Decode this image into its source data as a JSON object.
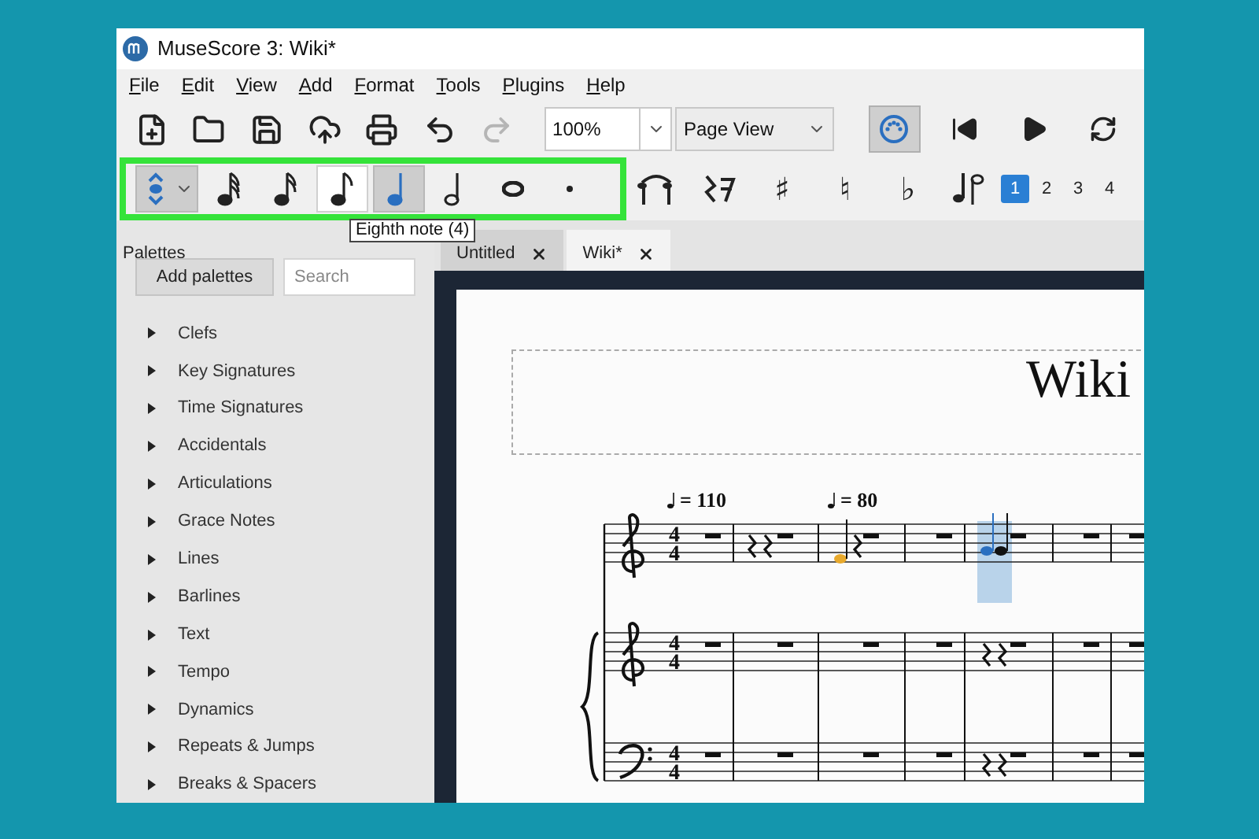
{
  "window": {
    "title": "MuseScore 3: Wiki*"
  },
  "menu": [
    "File",
    "Edit",
    "View",
    "Add",
    "Format",
    "Tools",
    "Plugins",
    "Help"
  ],
  "toolbar": [
    {
      "kind": "new",
      "disabled": false
    },
    {
      "kind": "open",
      "disabled": false
    },
    {
      "kind": "save",
      "disabled": false
    },
    {
      "kind": "upload",
      "disabled": false
    },
    {
      "kind": "print",
      "disabled": false
    },
    {
      "kind": "undo",
      "disabled": false
    },
    {
      "kind": "redo",
      "disabled": true
    }
  ],
  "zoom": {
    "value": "100%"
  },
  "view_mode": {
    "value": "Page View"
  },
  "playback": [
    {
      "kind": "midi",
      "selected": true
    },
    {
      "kind": "rewind",
      "selected": false
    },
    {
      "kind": "play",
      "selected": false
    },
    {
      "kind": "loop",
      "selected": false
    }
  ],
  "note_tools": [
    {
      "kind": "input-mode",
      "selected": true,
      "hovered": false
    },
    {
      "kind": "thirty-second",
      "selected": false,
      "hovered": false
    },
    {
      "kind": "sixteenth",
      "selected": false,
      "hovered": false
    },
    {
      "kind": "eighth",
      "selected": false,
      "hovered": true
    },
    {
      "kind": "quarter",
      "selected": true,
      "hovered": false
    },
    {
      "kind": "half",
      "selected": false,
      "hovered": false
    },
    {
      "kind": "whole",
      "selected": false,
      "hovered": false
    },
    {
      "kind": "dot",
      "selected": false,
      "hovered": false
    }
  ],
  "edit_tools": [
    {
      "kind": "tie"
    },
    {
      "kind": "rest"
    },
    {
      "kind": "accidental",
      "label": "♯"
    },
    {
      "kind": "accidental",
      "label": "♮"
    },
    {
      "kind": "accidental",
      "label": "♭"
    },
    {
      "kind": "flip"
    }
  ],
  "voices": [
    {
      "label": "1",
      "selected": true
    },
    {
      "label": "2",
      "selected": false
    },
    {
      "label": "3",
      "selected": false
    },
    {
      "label": "4",
      "selected": false
    }
  ],
  "tooltip": "Eighth note (4)",
  "palettes": {
    "title": "Palettes",
    "add_button": "Add palettes",
    "search": {
      "placeholder": "Search"
    },
    "items": [
      "Clefs",
      "Key Signatures",
      "Time Signatures",
      "Accidentals",
      "Articulations",
      "Grace Notes",
      "Lines",
      "Barlines",
      "Text",
      "Tempo",
      "Dynamics",
      "Repeats & Jumps",
      "Breaks & Spacers"
    ]
  },
  "tabs": [
    {
      "label": "Untitled",
      "selected": false
    },
    {
      "label": "Wiki*",
      "selected": true
    }
  ],
  "score": {
    "title": "Wiki",
    "tempo_marks": [
      "= 110",
      "= 80"
    ],
    "staves": [
      {
        "kind": "treble",
        "time": [
          "4",
          "4"
        ]
      },
      {
        "kind": "treble",
        "time": [
          "4",
          "4"
        ]
      },
      {
        "kind": "bass",
        "time": [
          "4",
          "4"
        ]
      }
    ]
  }
}
